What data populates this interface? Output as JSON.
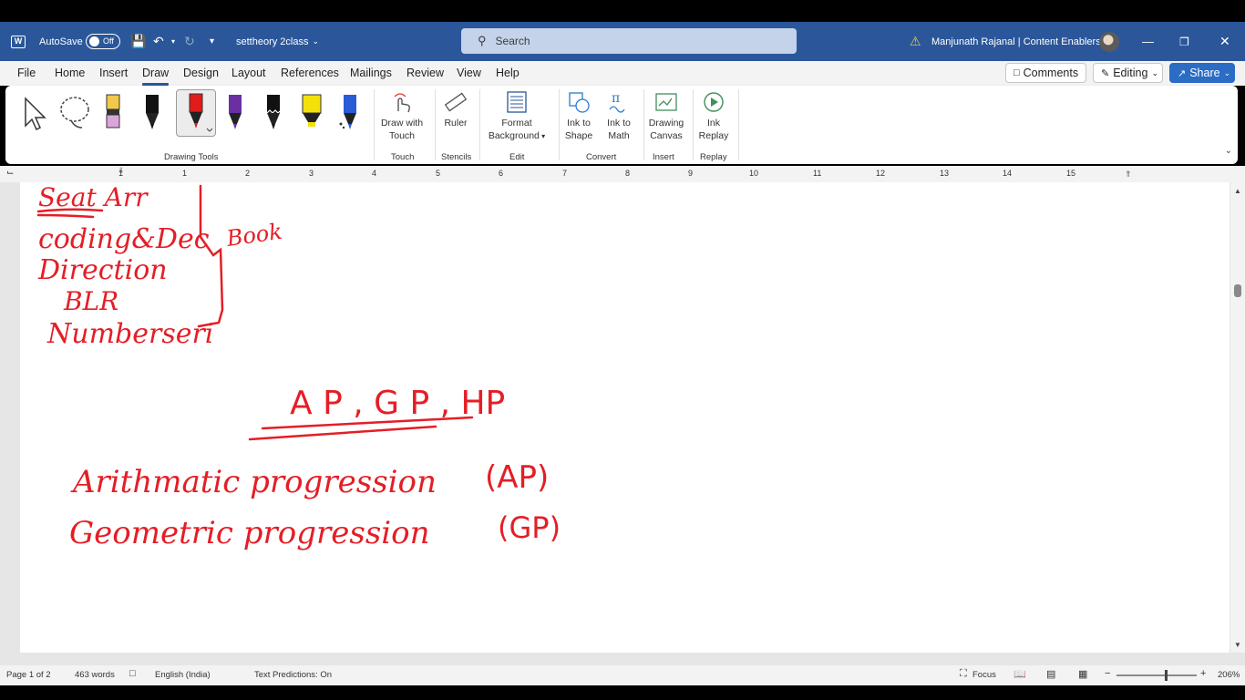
{
  "titlebar": {
    "app_logo": "W",
    "autosave_label": "AutoSave",
    "autosave_state": "Off",
    "doc_title": "settheory 2class",
    "search_placeholder": "Search",
    "user_name": "Manjunath Rajanal | Content Enablers",
    "icons": [
      "word-logo-icon",
      "save-icon",
      "undo-icon",
      "redo-icon",
      "customize-qat-icon",
      "search-icon",
      "warning-icon",
      "minimize-icon",
      "restore-icon",
      "close-icon"
    ]
  },
  "tabs": [
    "File",
    "Home",
    "Insert",
    "Draw",
    "Design",
    "Layout",
    "References",
    "Mailings",
    "Review",
    "View",
    "Help"
  ],
  "active_tab": "Draw",
  "tab_buttons": {
    "comments": "Comments",
    "editing": "Editing",
    "share": "Share"
  },
  "ribbon": {
    "groups": {
      "drawing_tools": "Drawing Tools",
      "touch": "Touch",
      "stencils": "Stencils",
      "edit": "Edit",
      "convert": "Convert",
      "insert": "Insert",
      "replay": "Replay"
    },
    "pens": [
      {
        "name": "select",
        "color": "#ffffff"
      },
      {
        "name": "lasso",
        "color": "#ffffff"
      },
      {
        "name": "eraser",
        "color": "#d9a6d9"
      },
      {
        "name": "black-pen",
        "color": "#111111"
      },
      {
        "name": "red-pen",
        "color": "#e21b1b"
      },
      {
        "name": "purple-pen",
        "color": "#6b2fa3"
      },
      {
        "name": "black-pencil",
        "color": "#111111"
      },
      {
        "name": "yellow-highlighter",
        "color": "#f5e10a"
      },
      {
        "name": "galaxy-pen",
        "color": "#2a5bd7"
      }
    ],
    "buttons": {
      "draw_with_touch_1": "Draw with",
      "draw_with_touch_2": "Touch",
      "ruler": "Ruler",
      "format_bg_1": "Format",
      "format_bg_2": "Background",
      "ink_to_shape_1": "Ink to",
      "ink_to_shape_2": "Shape",
      "ink_to_math_1": "Ink to",
      "ink_to_math_2": "Math",
      "drawing_canvas_1": "Drawing",
      "drawing_canvas_2": "Canvas",
      "ink_replay_1": "Ink",
      "ink_replay_2": "Replay"
    }
  },
  "ruler_numbers": [
    "1",
    "1",
    "2",
    "3",
    "4",
    "5",
    "6",
    "7",
    "8",
    "9",
    "10",
    "11",
    "12",
    "13",
    "14",
    "15"
  ],
  "ink": {
    "color": "#e41e26",
    "lines": {
      "l1": "Seat Arr",
      "l2": "coding&Dec",
      "l3": "Direction",
      "l4": "BLR",
      "l5": "Numberseri",
      "side": "Book",
      "heading": "A P , G P ,   HP",
      "ap": "Arithmatic progression",
      "ap_abbr": "(AP)",
      "gp": "Geometric progression",
      "gp_abbr": "(GP)"
    }
  },
  "status": {
    "page": "Page 1 of 2",
    "words": "463 words",
    "language": "English (India)",
    "predictions": "Text Predictions: On",
    "focus": "Focus",
    "zoom": "206%",
    "zoom_minus": "−",
    "zoom_plus": "+"
  }
}
